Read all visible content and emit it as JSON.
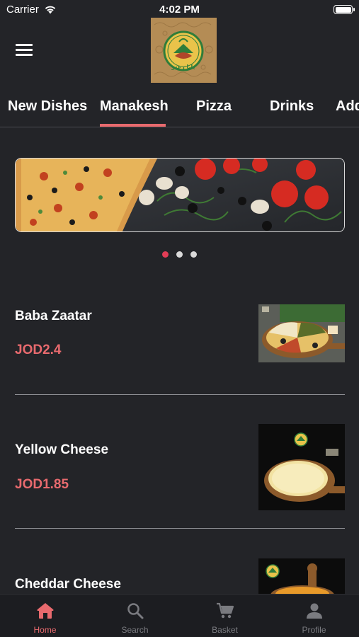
{
  "status_bar": {
    "carrier": "Carrier",
    "time": "4:02 PM"
  },
  "header": {
    "menu_icon": "hamburger-menu-icon",
    "logo_text": "بابا زعتر"
  },
  "tabs": [
    {
      "label": "New Dishes"
    },
    {
      "label": "Manakesh",
      "active": true
    },
    {
      "label": "Pizza"
    },
    {
      "label": "Drinks"
    },
    {
      "label": "Add"
    }
  ],
  "banner": {
    "dots": 3,
    "active_dot": 0
  },
  "items": [
    {
      "name": "Baba Zaatar",
      "price": "JOD2.4"
    },
    {
      "name": "Yellow Cheese",
      "price": "JOD1.85"
    },
    {
      "name": "Cheddar Cheese",
      "price": ""
    }
  ],
  "bottom_nav": [
    {
      "label": "Home",
      "icon": "home-icon",
      "active": true
    },
    {
      "label": "Search",
      "icon": "search-icon"
    },
    {
      "label": "Basket",
      "icon": "cart-icon"
    },
    {
      "label": "Profile",
      "icon": "profile-icon"
    }
  ],
  "colors": {
    "background": "#232428",
    "accent": "#e86a6e",
    "dot_active": "#e23d56",
    "inactive": "#7a7b80"
  }
}
